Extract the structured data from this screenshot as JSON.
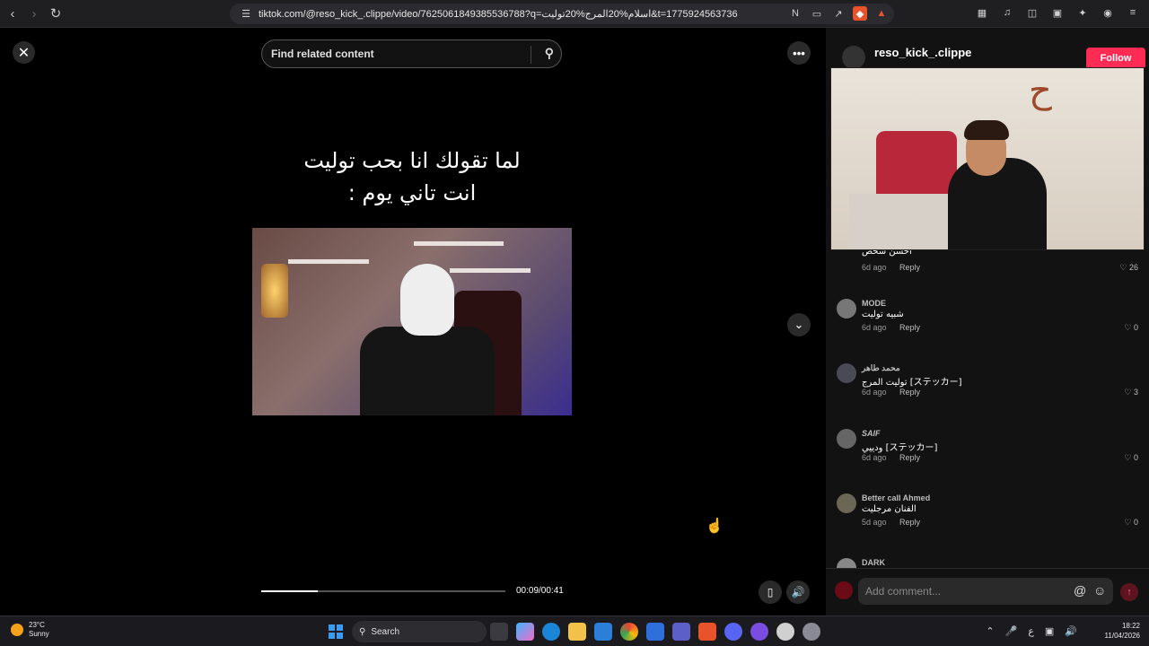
{
  "browser": {
    "url": "tiktok.com/@reso_kick_.clippe/video/7625061849385536788?q=اسلام%20المرج%20توليت&t=1775924563736"
  },
  "video": {
    "search_placeholder": "Find related content",
    "caption_line1": "لما تقولك انا بحب توليت",
    "caption_line2": "انت تاني يوم :",
    "time": "00:09/00:41",
    "progress_fraction": 0.23
  },
  "panel": {
    "author": "reso_kick_.clippe",
    "follow_label": "Follow",
    "comments": [
      {
        "user": "",
        "text": "احسن شخص",
        "age": "6d ago",
        "reply": "Reply",
        "likes": "26"
      },
      {
        "user": "MODE",
        "text": "شبيه توليت",
        "age": "6d ago",
        "reply": "Reply",
        "likes": "0"
      },
      {
        "user": "محمد طاهر",
        "text": "توليت المرج [ステッカー]",
        "age": "6d ago",
        "reply": "Reply",
        "likes": "3"
      },
      {
        "user": "SAIF",
        "text": "ودييي [ステッカー]",
        "age": "6d ago",
        "reply": "Reply",
        "likes": "0"
      },
      {
        "user": "Better call Ahmed",
        "text": "الفنان مرجليت",
        "age": "5d ago",
        "reply": "Reply",
        "likes": "0"
      },
      {
        "user": "DARK",
        "text": "",
        "age": "",
        "reply": "",
        "likes": ""
      }
    ],
    "comment_placeholder": "Add comment..."
  },
  "taskbar": {
    "temp": "23°C",
    "weather": "Sunny",
    "search_label": "Search",
    "time": "18:22",
    "date": "11/04/2026"
  }
}
